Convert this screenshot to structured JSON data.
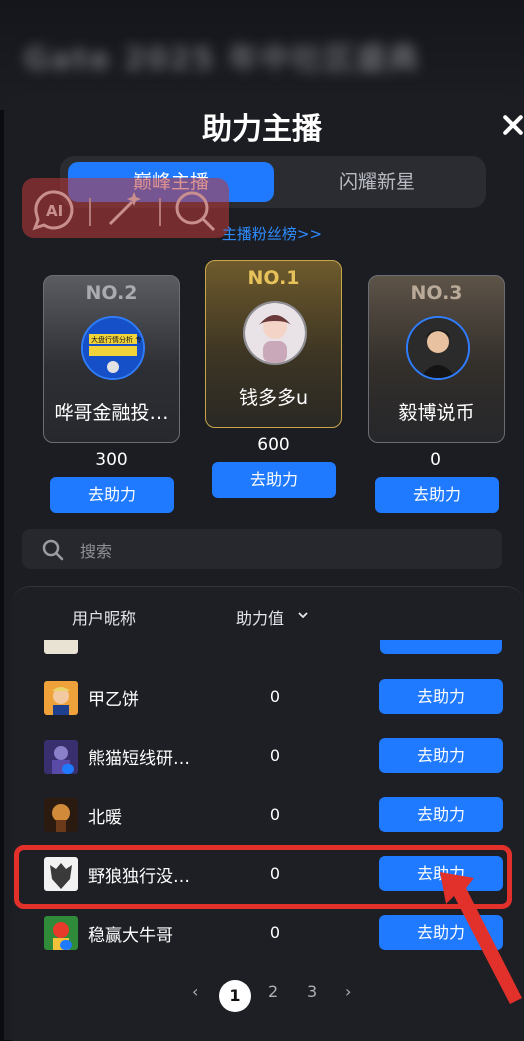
{
  "background_title": "Gate 2025 年中社区盛典",
  "dialog": {
    "title": "助力主播"
  },
  "tabs": [
    {
      "label": "巅峰主播",
      "active": true
    },
    {
      "label": "闪耀新星",
      "active": false
    }
  ],
  "fans_link": "主播粉丝榜>>",
  "podium": [
    {
      "rank_label": "NO.2",
      "name": "哗哥金融投…",
      "score": "300",
      "button": "去助力",
      "avatar_text": "大盘行情分析 专业山寨币精选"
    },
    {
      "rank_label": "NO.1",
      "name": "钱多多u",
      "score": "600",
      "button": "去助力"
    },
    {
      "rank_label": "NO.3",
      "name": "毅博说币",
      "score": "0",
      "button": "去助力"
    }
  ],
  "search": {
    "placeholder": "搜索"
  },
  "table": {
    "col_name": "用户昵称",
    "col_value": "助力值",
    "rows": [
      {
        "name": "甲乙饼",
        "value": "0",
        "button": "去助力"
      },
      {
        "name": "熊猫短线研…",
        "value": "0",
        "button": "去助力"
      },
      {
        "name": "北暖",
        "value": "0",
        "button": "去助力"
      },
      {
        "name": "野狼独行没…",
        "value": "0",
        "button": "去助力",
        "highlighted": true
      },
      {
        "name": "稳赢大牛哥",
        "value": "0",
        "button": "去助力"
      }
    ]
  },
  "pagination": {
    "prev": "‹",
    "pages": [
      "1",
      "2",
      "3"
    ],
    "current": "1",
    "next": "›"
  },
  "colors": {
    "accent": "#1f7aff",
    "highlight": "#e2302b",
    "gold": "#e7c25a"
  },
  "icons": [
    "close-icon",
    "ai-icon",
    "magic-wand-icon",
    "search-icon",
    "chevron-down-icon",
    "arrow-annotation-icon"
  ]
}
